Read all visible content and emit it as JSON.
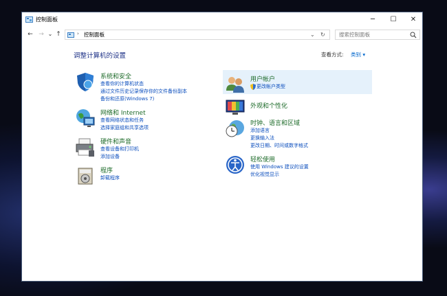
{
  "window": {
    "title": "控制面板",
    "minimize_glyph": "─",
    "maximize_glyph": "☐",
    "close_glyph": "✕"
  },
  "nav": {
    "back_glyph": "←",
    "forward_glyph": "→",
    "dropdown_glyph": "⌄",
    "up_glyph": "↑"
  },
  "address": {
    "separator": "›",
    "path": "控制面板",
    "dropdown_glyph": "⌄",
    "refresh_glyph": "↻"
  },
  "search": {
    "placeholder": "搜索控制面板"
  },
  "page": {
    "heading": "调整计算机的设置",
    "view_by_label": "查看方式:",
    "view_by_value": "类别 ▾"
  },
  "categories_left": [
    {
      "title": "系统和安全",
      "icon": "shield-icon",
      "links": [
        "查看你的计算机状态",
        "通过文件历史记录保存你的文件备份副本",
        "备份和还原(Windows 7)"
      ]
    },
    {
      "title": "网络和 Internet",
      "icon": "network-icon",
      "links": [
        "查看网络状态和任务",
        "选择家庭组和共享选项"
      ]
    },
    {
      "title": "硬件和声音",
      "icon": "printer-icon",
      "links": [
        "查看设备和打印机",
        "添加设备"
      ]
    },
    {
      "title": "程序",
      "icon": "programs-icon",
      "links": [
        "卸载程序"
      ]
    }
  ],
  "categories_right": [
    {
      "title": "用户帐户",
      "icon": "users-icon",
      "links": [
        "更改帐户类型"
      ],
      "selected": true
    },
    {
      "title": "外观和个性化",
      "icon": "appearance-icon",
      "links": []
    },
    {
      "title": "时钟、语言和区域",
      "icon": "clock-globe-icon",
      "links": [
        "添加语言",
        "更换输入法",
        "更改日期、时间或数字格式"
      ]
    },
    {
      "title": "轻松使用",
      "icon": "accessibility-icon",
      "links": [
        "使用 Windows 建议的设置",
        "优化视觉显示"
      ]
    }
  ]
}
